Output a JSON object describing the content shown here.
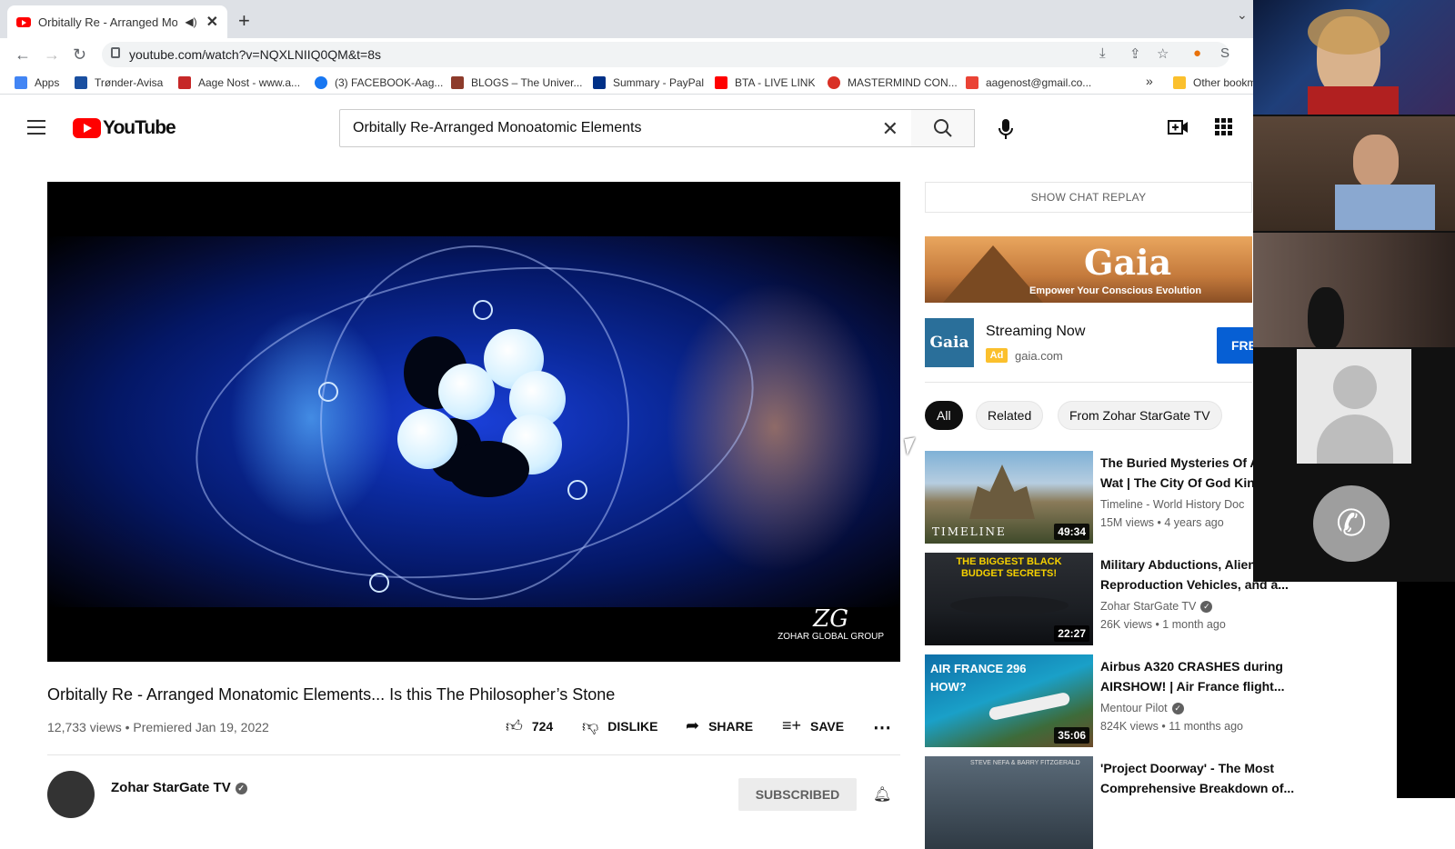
{
  "browser": {
    "tab_title": "Orbitally Re - Arranged Mon",
    "url": "youtube.com/watch?v=NQXLNIIQ0QM&t=8s",
    "bookmarks": [
      {
        "label": "Apps",
        "color": "#4285f4"
      },
      {
        "label": "Trønder-Avisa",
        "color": "#1a4fa0"
      },
      {
        "label": "Aage Nost - www.a...",
        "color": "#c62828"
      },
      {
        "label": "(3) FACEBOOK-Aag...",
        "color": "#1877f2"
      },
      {
        "label": "BLOGS – The Univer...",
        "color": "#8d3b2b"
      },
      {
        "label": "Summary - PayPal",
        "color": "#003087"
      },
      {
        "label": "BTA - LIVE LINK",
        "color": "#ff0000"
      },
      {
        "label": "MASTERMIND CON...",
        "color": "#d93025"
      },
      {
        "label": "aagenost@gmail.co...",
        "color": "#ea4335"
      }
    ],
    "overflow_label": "»",
    "other_bookmarks": "Other bookm"
  },
  "youtube": {
    "logo_text": "YouTube",
    "search_value": "Orbitally Re-Arranged Monoatomic Elements"
  },
  "video": {
    "watermark_brand": "ZOHAR GLOBAL GROUP",
    "title": "Orbitally Re - Arranged Monatomic Elements... Is this The Philosopher’s Stone",
    "meta": "12,733 views • Premiered Jan 19, 2022",
    "likes": "724",
    "dislike_label": "DISLIKE",
    "share_label": "SHARE",
    "save_label": "SAVE",
    "channel_name": "Zohar StarGate TV",
    "subscribe_label": "SUBSCRIBED"
  },
  "sidebar": {
    "chat_replay_label": "SHOW CHAT REPLAY",
    "ad": {
      "banner_brand": "Gaia",
      "banner_tagline": "Empower Your Conscious Evolution",
      "logo_text": "Gaia",
      "title": "Streaming Now",
      "badge": "Ad",
      "domain": "gaia.com",
      "cta": "FREE TRIAL"
    },
    "chips": [
      "All",
      "Related",
      "From Zohar StarGate TV"
    ],
    "recommendations": [
      {
        "title": "The Buried Mysteries Of Angkor Wat | The City Of God King",
        "channel": "Timeline - World History Doc",
        "meta": "15M views • 4 years ago",
        "duration": "49:34",
        "thumb_text": "TIMELINE"
      },
      {
        "title": "Military Abductions, Alien Reproduction Vehicles, and a...",
        "channel": "Zohar StarGate TV",
        "meta": "26K views • 1 month ago",
        "duration": "22:27",
        "thumb_text": "THE BIGGEST BLACK BUDGET SECRETS!"
      },
      {
        "title": "Airbus A320 CRASHES during AIRSHOW! | Air France flight...",
        "channel": "Mentour Pilot",
        "meta": "824K views • 11 months ago",
        "duration": "35:06",
        "thumb_text": "AIR FRANCE 296 HOW?"
      },
      {
        "title": "'Project Doorway' - The Most Comprehensive Breakdown of...",
        "channel": "",
        "meta": "",
        "duration": "",
        "thumb_text": "STEVE NEFA & BARRY FITZGERALD"
      }
    ]
  }
}
